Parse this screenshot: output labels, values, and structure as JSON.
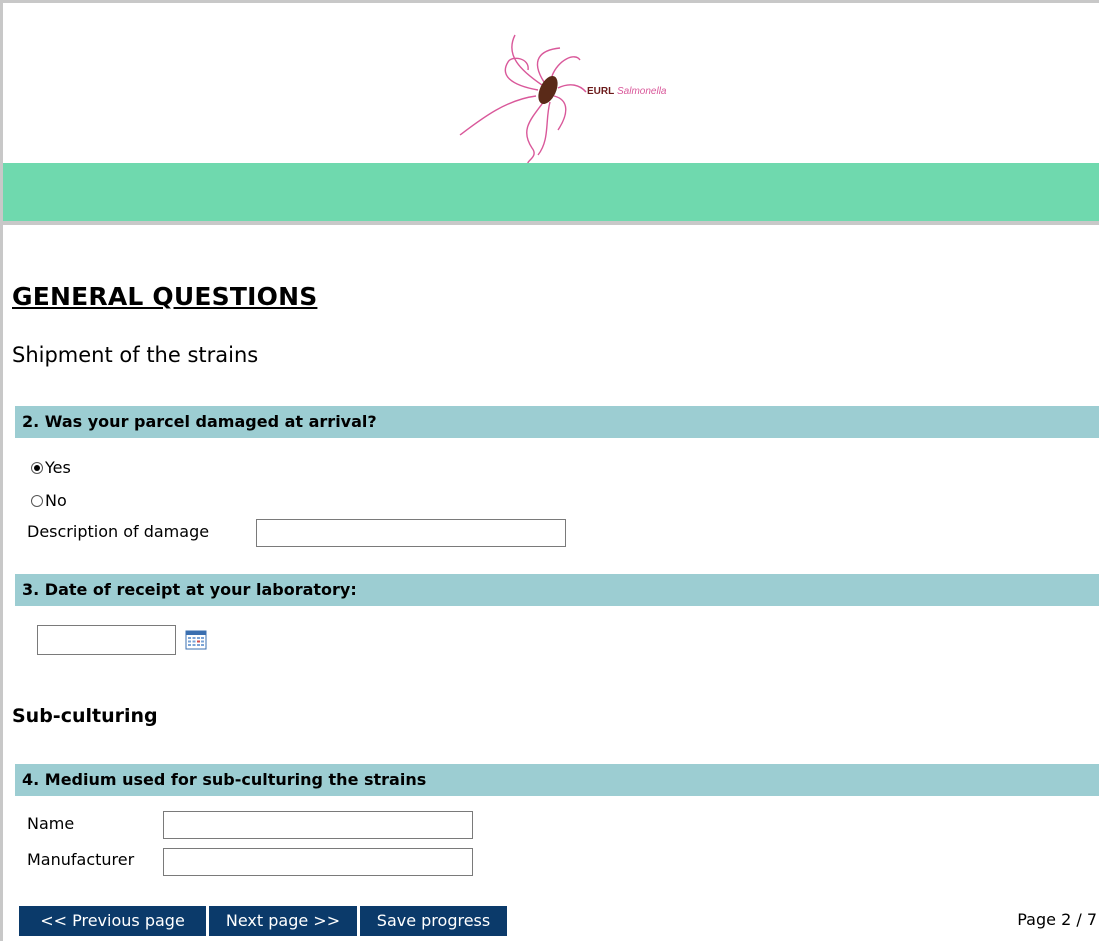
{
  "logo": {
    "brand": "EURL",
    "organism": "Salmonella"
  },
  "page": {
    "title": "GENERAL QUESTIONS",
    "subtitle": "Shipment of the strains"
  },
  "q2": {
    "label": "2.  Was your parcel damaged at arrival?",
    "options": [
      {
        "label": "Yes",
        "checked": true
      },
      {
        "label": "No",
        "checked": false
      }
    ],
    "damage_label": "Description of damage",
    "damage_value": ""
  },
  "q3": {
    "label": "3. Date of receipt at your laboratory:",
    "date_value": ""
  },
  "section": {
    "title": "Sub-culturing"
  },
  "q4": {
    "label": "4. Medium used for sub-culturing the strains",
    "name_label": "Name",
    "name_value": "",
    "manufacturer_label": "Manufacturer",
    "manufacturer_value": ""
  },
  "nav": {
    "prev": "<< Previous page",
    "next": "Next page >>",
    "save": "Save progress",
    "page_indicator": "Page 2 / 7"
  },
  "colors": {
    "green_band": "#6fd9ae",
    "question_bar": "#9ccdd2",
    "button_bg": "#0b3a6a"
  }
}
